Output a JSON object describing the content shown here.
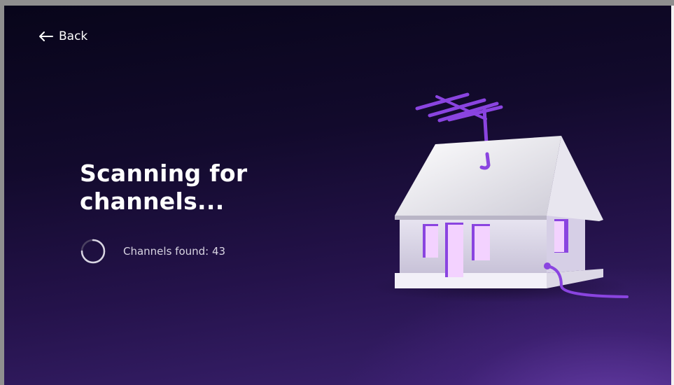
{
  "nav": {
    "back_label": "Back"
  },
  "main": {
    "title": "Scanning for channels...",
    "status_text": "Channels found: 43"
  },
  "icons": {
    "back": "arrow-left-icon",
    "spinner": "loading-spinner-icon",
    "illustration": "house-antenna-illustration"
  },
  "colors": {
    "background_top": "#08051a",
    "background_bottom": "#3c2272",
    "accent": "#8a44e0",
    "text": "#ffffff"
  }
}
